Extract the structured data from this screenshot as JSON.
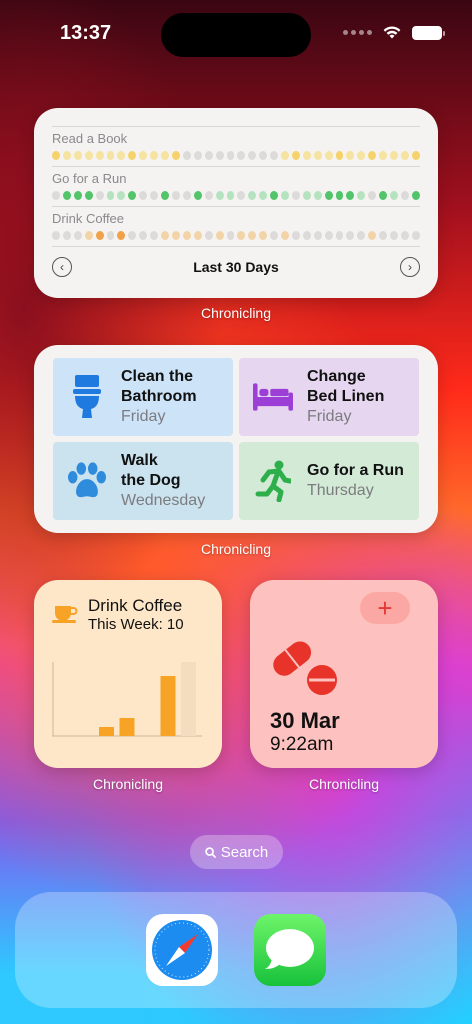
{
  "status_bar": {
    "time": "13:37"
  },
  "habit_widget": {
    "habits": [
      {
        "name": "Read a Book",
        "dots": [
          "#f6d36a",
          "#f6e3a0",
          "#f6e3a0",
          "#f6e3a0",
          "#f6e3a0",
          "#f6e3a0",
          "#f6e3a0",
          "#f6d36a",
          "#f6e3a0",
          "#f6e3a0",
          "#f6e3a0",
          "#f6d36a",
          "#dcdbd9",
          "#dcdbd9",
          "#dcdbd9",
          "#dcdbd9",
          "#dcdbd9",
          "#dcdbd9",
          "#dcdbd9",
          "#dcdbd9",
          "#dcdbd9",
          "#f6e3a0",
          "#f6d36a",
          "#f6e3a0",
          "#f6e3a0",
          "#f6e3a0",
          "#f6d36a",
          "#f6e3a0",
          "#f6e3a0",
          "#f6d36a",
          "#f6e3a0",
          "#f6e3a0",
          "#f6e3a0",
          "#f6d36a"
        ]
      },
      {
        "name": "Go for a Run",
        "dots": [
          "#dcdbd9",
          "#52c46a",
          "#52c46a",
          "#52c46a",
          "#dcdbd9",
          "#b6e3bf",
          "#b6e3bf",
          "#52c46a",
          "#dcdbd9",
          "#dcdbd9",
          "#52c46a",
          "#dcdbd9",
          "#dcdbd9",
          "#52c46a",
          "#dcdbd9",
          "#b6e3bf",
          "#b6e3bf",
          "#dcdbd9",
          "#b6e3bf",
          "#b6e3bf",
          "#52c46a",
          "#b6e3bf",
          "#dcdbd9",
          "#b6e3bf",
          "#b6e3bf",
          "#52c46a",
          "#52c46a",
          "#52c46a",
          "#b6e3bf",
          "#dcdbd9",
          "#52c46a",
          "#b6e3bf",
          "#dcdbd9",
          "#52c46a"
        ]
      },
      {
        "name": "Drink Coffee",
        "dots": [
          "#dcdbd9",
          "#dcdbd9",
          "#dcdbd9",
          "#f3d4a8",
          "#f0a14a",
          "#dcdbd9",
          "#f0a14a",
          "#dcdbd9",
          "#dcdbd9",
          "#dcdbd9",
          "#f3d4a8",
          "#f3d4a8",
          "#f3d4a8",
          "#f3d4a8",
          "#dcdbd9",
          "#f3d4a8",
          "#dcdbd9",
          "#f3d4a8",
          "#f3d4a8",
          "#f3d4a8",
          "#dcdbd9",
          "#f3d4a8",
          "#dcdbd9",
          "#dcdbd9",
          "#dcdbd9",
          "#dcdbd9",
          "#dcdbd9",
          "#dcdbd9",
          "#dcdbd9",
          "#f3d4a8",
          "#dcdbd9",
          "#dcdbd9",
          "#dcdbd9",
          "#dcdbd9"
        ]
      }
    ],
    "footer_title": "Last 30 Days",
    "prev_icon": "chevron-left-circle-icon",
    "next_icon": "chevron-right-circle-icon",
    "caption": "Chronicling"
  },
  "chores_widget": {
    "tiles": [
      {
        "title": "Clean the\nBathroom",
        "day": "Friday",
        "icon": "toilet-icon",
        "bg": "#cde3f7"
      },
      {
        "title": "Change\nBed Linen",
        "day": "Friday",
        "icon": "bed-icon",
        "bg": "#e6d6ef"
      },
      {
        "title": "Walk\nthe Dog",
        "day": "Wednesday",
        "icon": "paw-icon",
        "bg": "#cbe2ef"
      },
      {
        "title": "Go for a Run",
        "day": "Thursday",
        "icon": "runner-icon",
        "bg": "#d2ead6"
      }
    ],
    "caption": "Chronicling"
  },
  "coffee_widget": {
    "title": "Drink Coffee",
    "subtitle": "This Week: 10",
    "icon": "coffee-cup-icon",
    "accent": "#f7a325",
    "bars": [
      0,
      0,
      0.15,
      0.3,
      0,
      1.0,
      1.15
    ],
    "caption": "Chronicling"
  },
  "meds_widget": {
    "date": "30 Mar",
    "time": "9:22am",
    "icon": "pills-icon",
    "add_icon": "plus-icon",
    "caption": "Chronicling"
  },
  "search": {
    "label": "Search",
    "icon": "magnifier-icon"
  },
  "dock": {
    "apps": [
      {
        "name": "Safari",
        "icon": "safari-icon"
      },
      {
        "name": "Messages",
        "icon": "messages-icon"
      }
    ]
  }
}
